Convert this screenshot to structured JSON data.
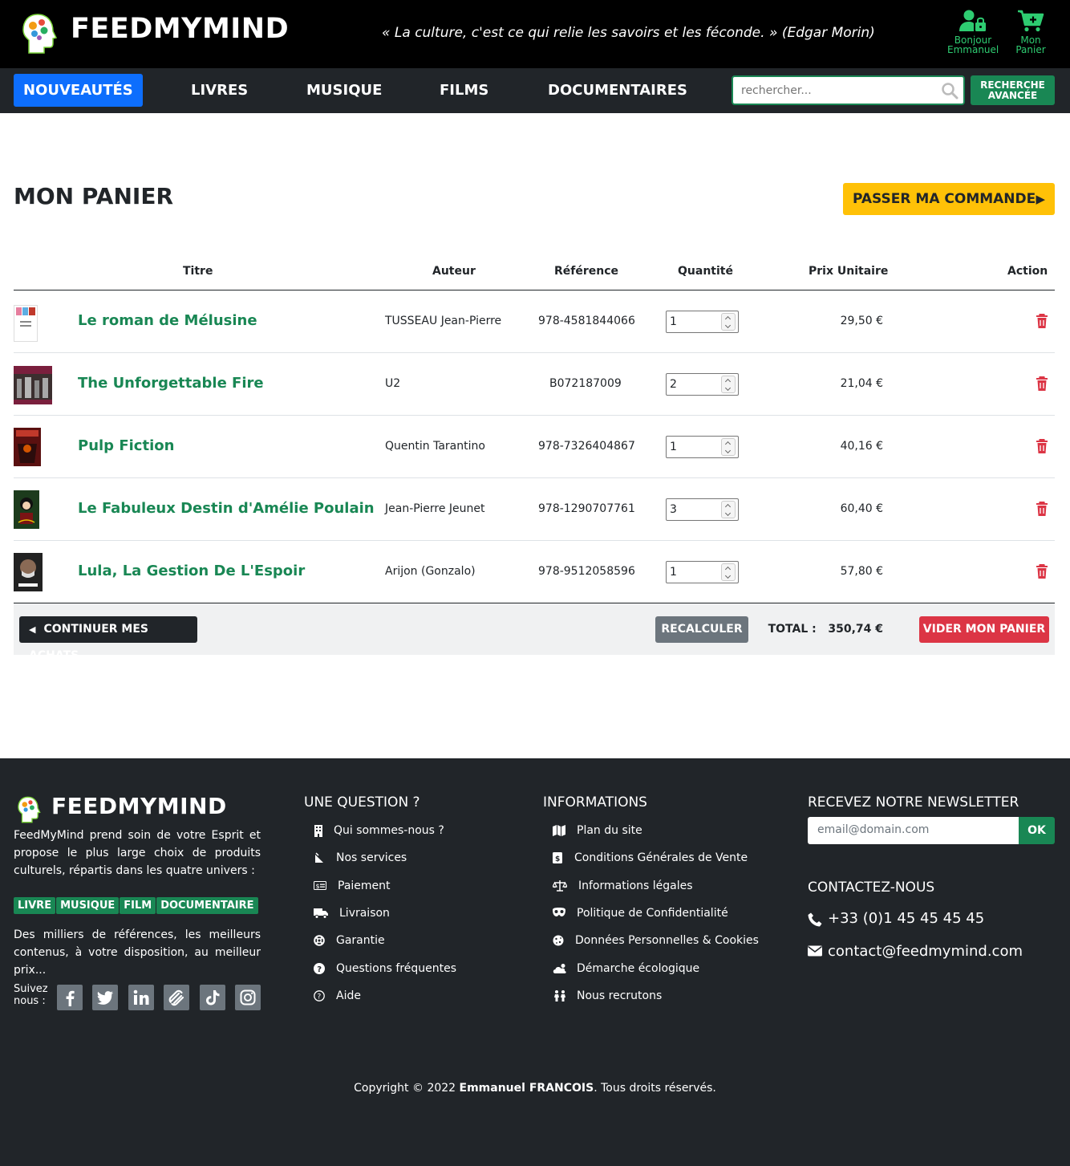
{
  "header": {
    "brand": "FEEDMYMIND",
    "quote": "« La culture, c'est ce qui relie les savoirs et les féconde. » (Edgar Morin)",
    "account_line1": "Bonjour",
    "account_line2": "Emmanuel",
    "cart_line1": "Mon",
    "cart_line2": "Panier",
    "accent_color": "#2ecc71"
  },
  "nav": {
    "items": [
      "NOUVEAUTÉS",
      "LIVRES",
      "MUSIQUE",
      "FILMS",
      "DOCUMENTAIRES"
    ],
    "active": "NOUVEAUTÉS",
    "search_placeholder": "rechercher...",
    "advanced_line1": "RECHERCHE",
    "advanced_line2": "AVANCÉE"
  },
  "cart": {
    "title": "MON PANIER",
    "order_button": "PASSER MA COMMANDE",
    "columns": {
      "title": "Titre",
      "author": "Auteur",
      "reference": "Référence",
      "quantity": "Quantité",
      "unit_price": "Prix Unitaire",
      "action": "Action"
    },
    "items": [
      {
        "title": "Le roman de Mélusine",
        "author": "TUSSEAU Jean-Pierre",
        "reference": "978-4581844066",
        "quantity": "1",
        "price": "29,50 €",
        "cover": "book-cover"
      },
      {
        "title": "The Unforgettable Fire",
        "author": "U2",
        "reference": "B072187009",
        "quantity": "2",
        "price": "21,04 €",
        "cover": "album-cover"
      },
      {
        "title": "Pulp Fiction",
        "author": "Quentin Tarantino",
        "reference": "978-7326404867",
        "quantity": "1",
        "price": "40,16 €",
        "cover": "movie-poster"
      },
      {
        "title": "Le Fabuleux Destin d'Amélie Poulain",
        "author": "Jean-Pierre Jeunet",
        "reference": "978-1290707761",
        "quantity": "3",
        "price": "60,40 €",
        "cover": "movie-poster"
      },
      {
        "title": "Lula, La Gestion De L'Espoir",
        "author": "Arijon (Gonzalo)",
        "reference": "978-9512058596",
        "quantity": "1",
        "price": "57,80 €",
        "cover": "documentary-poster"
      }
    ],
    "continue_button": "CONTINUER MES ACHATS",
    "recalc_button": "RECALCULER",
    "total_label": "TOTAL :",
    "total_value": "350,74 €",
    "empty_button": "VIDER MON PANIER"
  },
  "footer": {
    "brand": "FEEDMYMIND",
    "description": "FeedMyMind prend soin de votre Esprit et propose le plus large choix de produits culturels, répartis dans les quatre univers :",
    "badges": [
      "LIVRE",
      "MUSIQUE",
      "FILM",
      "DOCUMENTAIRE"
    ],
    "tagline": "Des milliers de références, les meilleurs contenus, à votre disposition, au meilleur prix...",
    "follow_line1": "Suivez",
    "follow_line2": "nous :",
    "social": [
      "facebook-icon",
      "twitter-icon",
      "linkedin-icon",
      "squarespace-icon",
      "tiktok-icon",
      "instagram-icon"
    ],
    "question_title": "UNE QUESTION ?",
    "question_links": [
      "Qui sommes-nous ?",
      "Nos services",
      "Paiement",
      "Livraison",
      "Garantie",
      "Questions fréquentes",
      "Aide"
    ],
    "info_title": "INFORMATIONS",
    "info_links": [
      "Plan du site",
      "Conditions Générales de Vente",
      "Informations légales",
      "Politique de Confidentialité",
      "Données Personnelles & Cookies",
      "Démarche écologique",
      "Nous recrutons"
    ],
    "newsletter_title": "RECEVEZ NOTRE NEWSLETTER",
    "newsletter_placeholder": "email@domain.com",
    "newsletter_button": "OK",
    "contact_title": "CONTACTEZ-NOUS",
    "phone": "+33 (0)1 45 45 45 45",
    "email": "contact@feedmymind.com",
    "copyright_pre": "Copyright © 2022 ",
    "copyright_name": "Emmanuel FRANCOIS",
    "copyright_post": ". Tous droits réservés."
  }
}
